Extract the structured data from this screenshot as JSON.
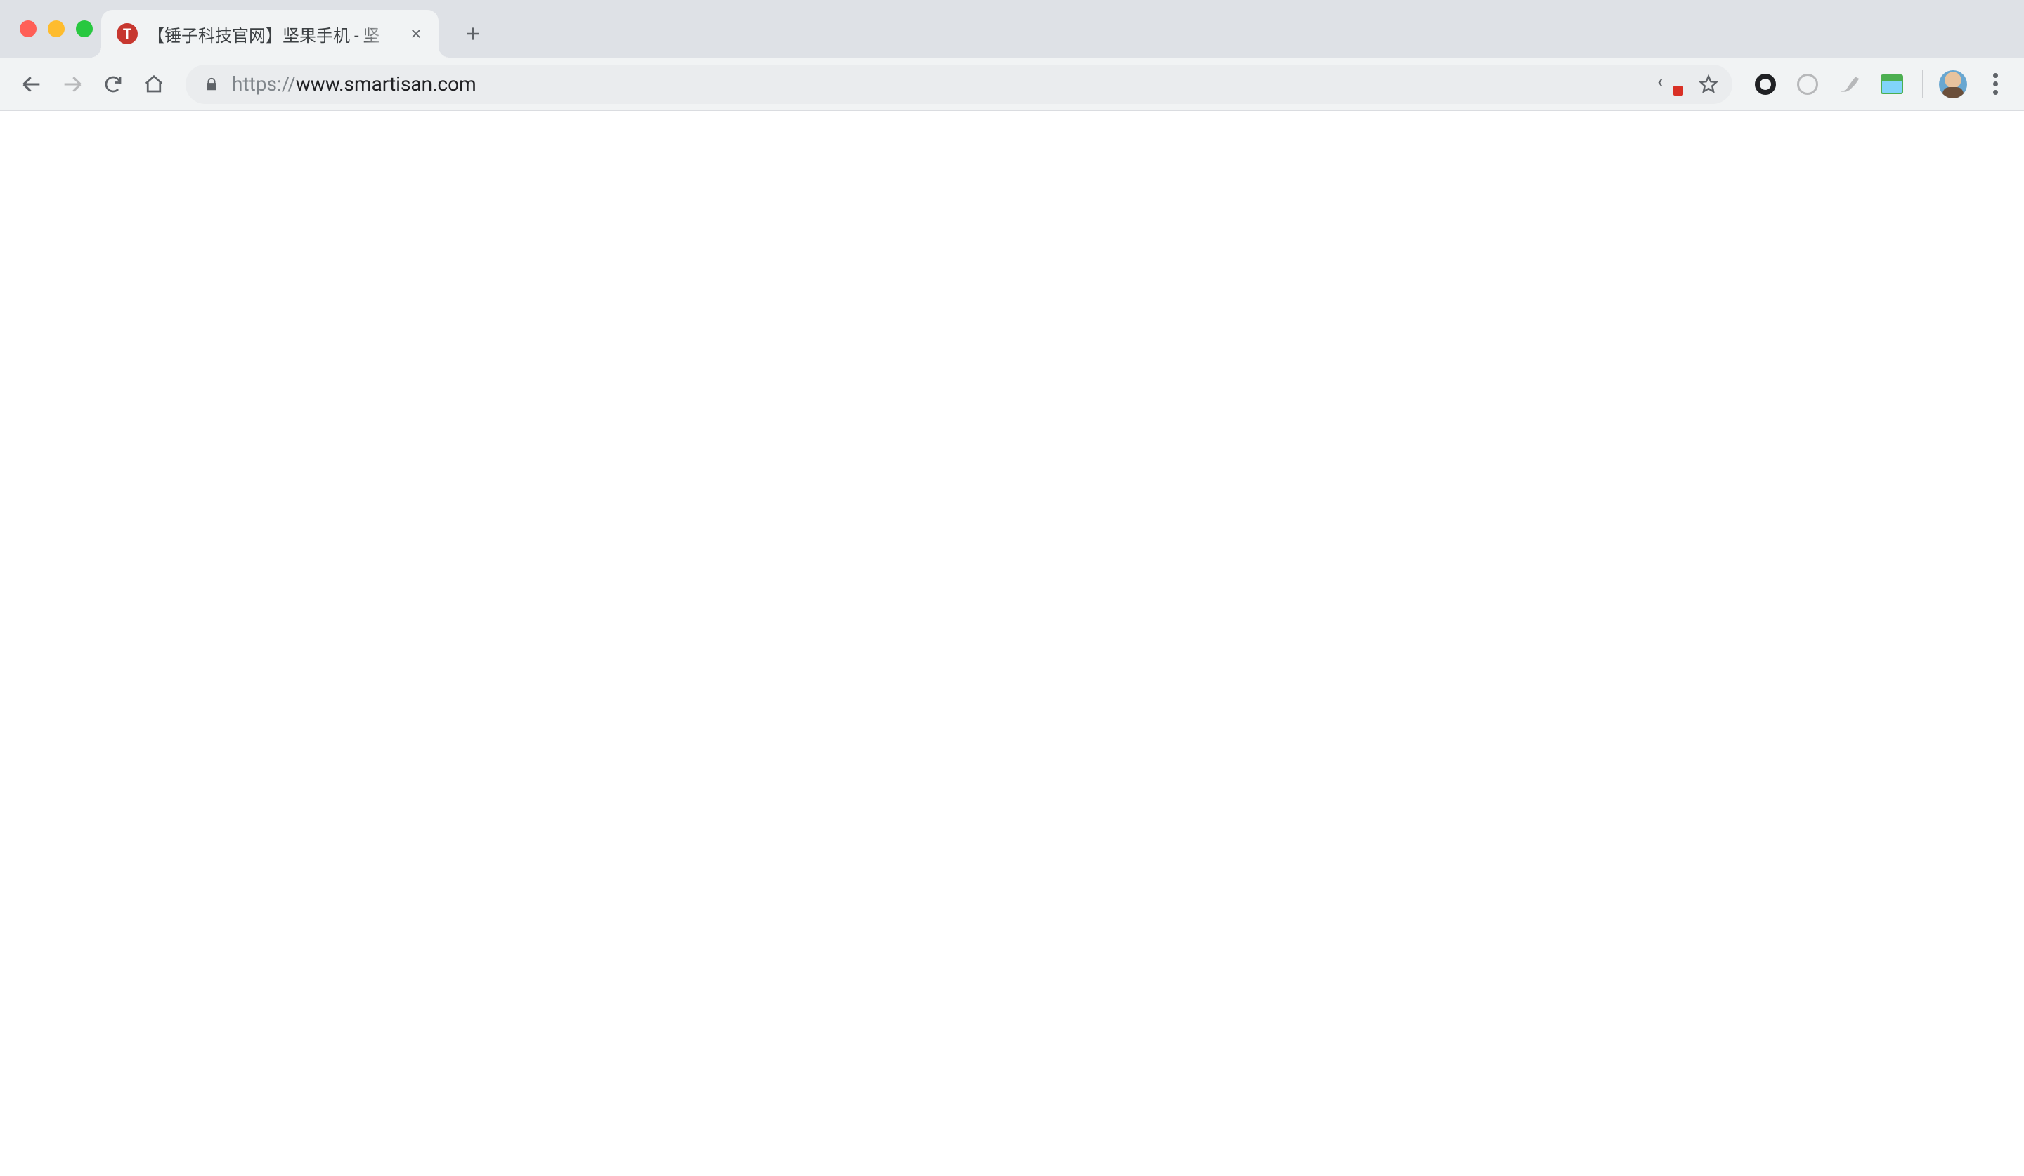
{
  "window": {
    "tab": {
      "favicon_letter": "T",
      "title": "【锤子科技官网】坚果手机 - 坚"
    }
  },
  "toolbar": {
    "url_scheme": "https://",
    "url_host": "www.smartisan.com"
  }
}
